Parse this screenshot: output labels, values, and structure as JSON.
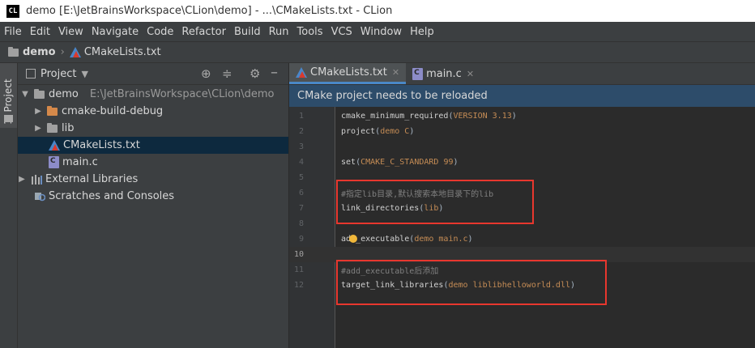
{
  "window": {
    "title": "demo [E:\\JetBrainsWorkspace\\CLion\\demo] - ...\\CMakeLists.txt - CLion",
    "logo": "CL"
  },
  "menu": [
    "File",
    "Edit",
    "View",
    "Navigate",
    "Code",
    "Refactor",
    "Build",
    "Run",
    "Tools",
    "VCS",
    "Window",
    "Help"
  ],
  "breadcrumb": {
    "project": "demo",
    "file": "CMakeLists.txt"
  },
  "left_strip": {
    "tab_label": "1: Project"
  },
  "project_panel": {
    "title": "Project",
    "tree": [
      {
        "label": "demo",
        "path": "E:\\JetBrainsWorkspace\\CLion\\demo"
      },
      {
        "label": "cmake-build-debug"
      },
      {
        "label": "lib"
      },
      {
        "label": "CMakeLists.txt"
      },
      {
        "label": "main.c"
      },
      {
        "label": "External Libraries"
      },
      {
        "label": "Scratches and Consoles"
      }
    ]
  },
  "tabs": [
    {
      "label": "CMakeLists.txt",
      "active": true
    },
    {
      "label": "main.c",
      "active": false
    }
  ],
  "notification": "CMake project needs to be reloaded",
  "code": {
    "line_numbers": [
      "1",
      "2",
      "3",
      "4",
      "5",
      "6",
      "7",
      "8",
      "9",
      "10",
      "11",
      "12"
    ],
    "l1": {
      "fn": "cmake_minimum_required",
      "args": "VERSION 3.13"
    },
    "l2": {
      "fn": "project",
      "args": "demo C"
    },
    "l4": {
      "fn": "set",
      "args": "CMAKE_C_STANDARD 99"
    },
    "l6": {
      "comment": "#指定lib目录,默认搜索本地目录下的lib"
    },
    "l7": {
      "fn": "link_directories",
      "args": "lib"
    },
    "l9": {
      "fn_a": "ad",
      "fn_b": "_executable",
      "args": "demo main.c"
    },
    "l11": {
      "comment": "#add_executable后添加"
    },
    "l12": {
      "fn": "target_link_libraries",
      "args": "demo liblibhelloworld.dll"
    }
  },
  "colors": {
    "highlight_box": "#e8372e",
    "selection": "#0d293e",
    "notification_bg": "#2d4c6a"
  }
}
